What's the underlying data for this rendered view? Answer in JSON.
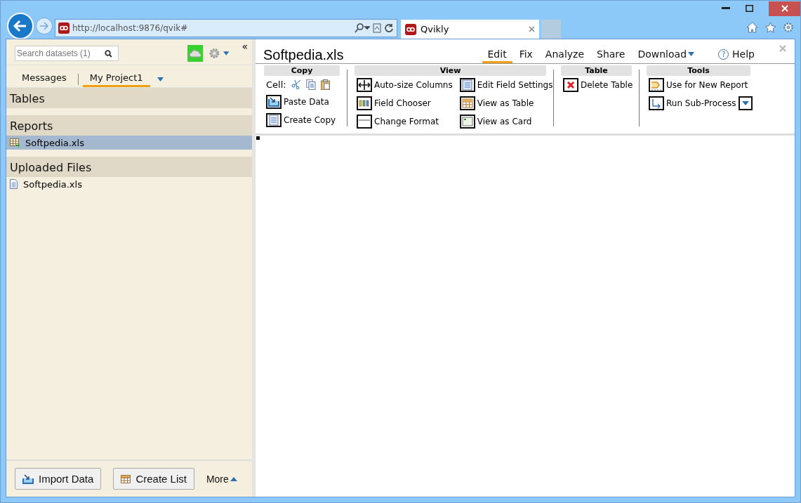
{
  "browser": {
    "url": "http://localhost:9876/qvik#",
    "tab_title": "Qvikly"
  },
  "sidebar": {
    "search": {
      "placeholder": "Search datasets (1)"
    },
    "collapse": "«",
    "tabs": [
      {
        "label": "Messages",
        "selected": false
      },
      {
        "label": "My Project1",
        "selected": true
      }
    ],
    "sections": [
      {
        "title": "Tables"
      },
      {
        "title": "Reports",
        "items": [
          {
            "label": "Softpedia.xls",
            "kind": "report",
            "selected": true
          }
        ]
      },
      {
        "title": "Uploaded Files",
        "items": [
          {
            "label": "Softpedia.xls",
            "kind": "file",
            "selected": false
          }
        ]
      }
    ],
    "footer": [
      {
        "label": "Import Data",
        "kind": "import"
      },
      {
        "label": "Create List",
        "kind": "list"
      }
    ],
    "more": "More"
  },
  "document": {
    "title": "Softpedia.xls",
    "menu": [
      {
        "label": "Edit",
        "kind": "plain",
        "selected": true
      },
      {
        "label": "Fix",
        "kind": "plain",
        "selected": false
      },
      {
        "label": "Analyze",
        "kind": "plain",
        "selected": false
      },
      {
        "label": "Share",
        "kind": "plain",
        "selected": false
      },
      {
        "label": "Download",
        "kind": "dropdown",
        "selected": false
      },
      {
        "label": "Help",
        "kind": "help",
        "icon": "?",
        "selected": false
      }
    ],
    "ribbon": [
      {
        "title": "Copy",
        "cell_label": "Cell:",
        "columns": [
          [
            {
              "label": "Paste Data",
              "kind": "paste"
            },
            {
              "label": "Create Copy",
              "kind": "copy"
            }
          ]
        ]
      },
      {
        "title": "View",
        "columns": [
          [
            {
              "label": "Auto-size Columns",
              "kind": "resize"
            },
            {
              "label": "Field Chooser",
              "kind": "fields"
            },
            {
              "label": "Change Format",
              "kind": "format"
            }
          ],
          [
            {
              "label": "Edit Field Settings",
              "kind": "settings"
            },
            {
              "label": "View as Table",
              "kind": "table"
            },
            {
              "label": "View as Card",
              "kind": "card"
            }
          ]
        ]
      },
      {
        "title": "Table",
        "columns": [
          [
            {
              "label": "Delete Table",
              "kind": "delete"
            }
          ]
        ]
      },
      {
        "title": "Tools",
        "columns": [
          [
            {
              "label": "Use for New Report",
              "kind": "report"
            },
            {
              "label": "Run Sub-Process",
              "kind": "subprocess",
              "dropdown": true
            }
          ]
        ]
      }
    ]
  }
}
